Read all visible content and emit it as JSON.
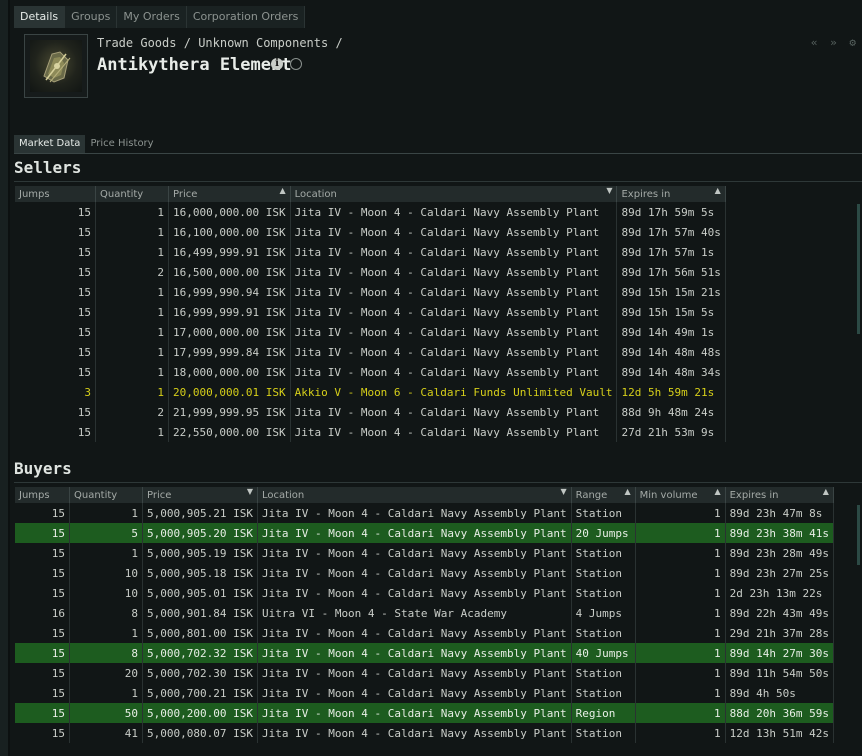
{
  "tabs": [
    "Details",
    "Groups",
    "My Orders",
    "Corporation Orders"
  ],
  "breadcrumb": [
    "Trade Goods",
    "/",
    "Unknown Components",
    "/"
  ],
  "item_name": "Antikythera Element",
  "subtabs": [
    "Market Data",
    "Price History"
  ],
  "nav_icons": [
    "«",
    "»",
    "⚙"
  ],
  "sellers": {
    "title": "Sellers",
    "columns": [
      "Jumps",
      "Quantity",
      "Price",
      "Location",
      "Expires in"
    ],
    "rows": [
      [
        "15",
        "1",
        "16,000,000.00 ISK",
        "Jita IV - Moon 4 - Caldari Navy Assembly Plant",
        "89d 17h 59m 5s"
      ],
      [
        "15",
        "1",
        "16,100,000.00 ISK",
        "Jita IV - Moon 4 - Caldari Navy Assembly Plant",
        "89d 17h 57m 40s"
      ],
      [
        "15",
        "1",
        "16,499,999.91 ISK",
        "Jita IV - Moon 4 - Caldari Navy Assembly Plant",
        "89d 17h 57m 1s"
      ],
      [
        "15",
        "2",
        "16,500,000.00 ISK",
        "Jita IV - Moon 4 - Caldari Navy Assembly Plant",
        "89d 17h 56m 51s"
      ],
      [
        "15",
        "1",
        "16,999,990.94 ISK",
        "Jita IV - Moon 4 - Caldari Navy Assembly Plant",
        "89d 15h 15m 21s"
      ],
      [
        "15",
        "1",
        "16,999,999.91 ISK",
        "Jita IV - Moon 4 - Caldari Navy Assembly Plant",
        "89d 15h 15m 5s"
      ],
      [
        "15",
        "1",
        "17,000,000.00 ISK",
        "Jita IV - Moon 4 - Caldari Navy Assembly Plant",
        "89d 14h 49m 1s"
      ],
      [
        "15",
        "1",
        "17,999,999.84 ISK",
        "Jita IV - Moon 4 - Caldari Navy Assembly Plant",
        "89d 14h 48m 48s"
      ],
      [
        "15",
        "1",
        "18,000,000.00 ISK",
        "Jita IV - Moon 4 - Caldari Navy Assembly Plant",
        "89d 14h 48m 34s"
      ],
      [
        "3",
        "1",
        "20,000,000.01 ISK",
        "Akkio V - Moon 6 - Caldari Funds Unlimited Vault",
        "12d 5h 59m 21s"
      ],
      [
        "15",
        "2",
        "21,999,999.95 ISK",
        "Jita IV - Moon 4 - Caldari Navy Assembly Plant",
        "88d 9h 48m 24s"
      ],
      [
        "15",
        "1",
        "22,550,000.00 ISK",
        "Jita IV - Moon 4 - Caldari Navy Assembly Plant",
        "27d 21h 53m 9s"
      ]
    ],
    "highlight_color": "#d6cf1a"
  },
  "buyers": {
    "title": "Buyers",
    "columns": [
      "Jumps",
      "Quantity",
      "Price",
      "Location",
      "Range",
      "Min volume",
      "Expires in"
    ],
    "rows": [
      [
        "15",
        "1",
        "5,000,905.21 ISK",
        "Jita IV - Moon 4 - Caldari Navy Assembly Plant",
        "Station",
        "1",
        "89d 23h 47m 8s"
      ],
      [
        "15",
        "5",
        "5,000,905.20 ISK",
        "Jita IV - Moon 4 - Caldari Navy Assembly Plant",
        "20 Jumps",
        "1",
        "89d 23h 38m 41s"
      ],
      [
        "15",
        "1",
        "5,000,905.19 ISK",
        "Jita IV - Moon 4 - Caldari Navy Assembly Plant",
        "Station",
        "1",
        "89d 23h 28m 49s"
      ],
      [
        "15",
        "10",
        "5,000,905.18 ISK",
        "Jita IV - Moon 4 - Caldari Navy Assembly Plant",
        "Station",
        "1",
        "89d 23h 27m 25s"
      ],
      [
        "15",
        "10",
        "5,000,905.01 ISK",
        "Jita IV - Moon 4 - Caldari Navy Assembly Plant",
        "Station",
        "1",
        "2d 23h 13m 22s"
      ],
      [
        "16",
        "8",
        "5,000,901.84 ISK",
        "Uitra VI - Moon 4 - State War Academy",
        "4 Jumps",
        "1",
        "89d 22h 43m 49s"
      ],
      [
        "15",
        "1",
        "5,000,801.00 ISK",
        "Jita IV - Moon 4 - Caldari Navy Assembly Plant",
        "Station",
        "1",
        "29d 21h 37m 28s"
      ],
      [
        "15",
        "8",
        "5,000,702.32 ISK",
        "Jita IV - Moon 4 - Caldari Navy Assembly Plant",
        "40 Jumps",
        "1",
        "89d 14h 27m 30s"
      ],
      [
        "15",
        "20",
        "5,000,702.30 ISK",
        "Jita IV - Moon 4 - Caldari Navy Assembly Plant",
        "Station",
        "1",
        "89d 11h 54m 50s"
      ],
      [
        "15",
        "1",
        "5,000,700.21 ISK",
        "Jita IV - Moon 4 - Caldari Navy Assembly Plant",
        "Station",
        "1",
        "89d 4h 50s"
      ],
      [
        "15",
        "50",
        "5,000,200.00 ISK",
        "Jita IV - Moon 4 - Caldari Navy Assembly Plant",
        "Region",
        "1",
        "88d 20h 36m 59s"
      ],
      [
        "15",
        "41",
        "5,000,080.07 ISK",
        "Jita IV - Moon 4 - Caldari Navy Assembly Plant",
        "Station",
        "1",
        "12d 13h 51m 42s"
      ]
    ],
    "highlighted_rows": [
      1,
      7,
      10
    ],
    "highlight_color": "#1d5c1f"
  }
}
